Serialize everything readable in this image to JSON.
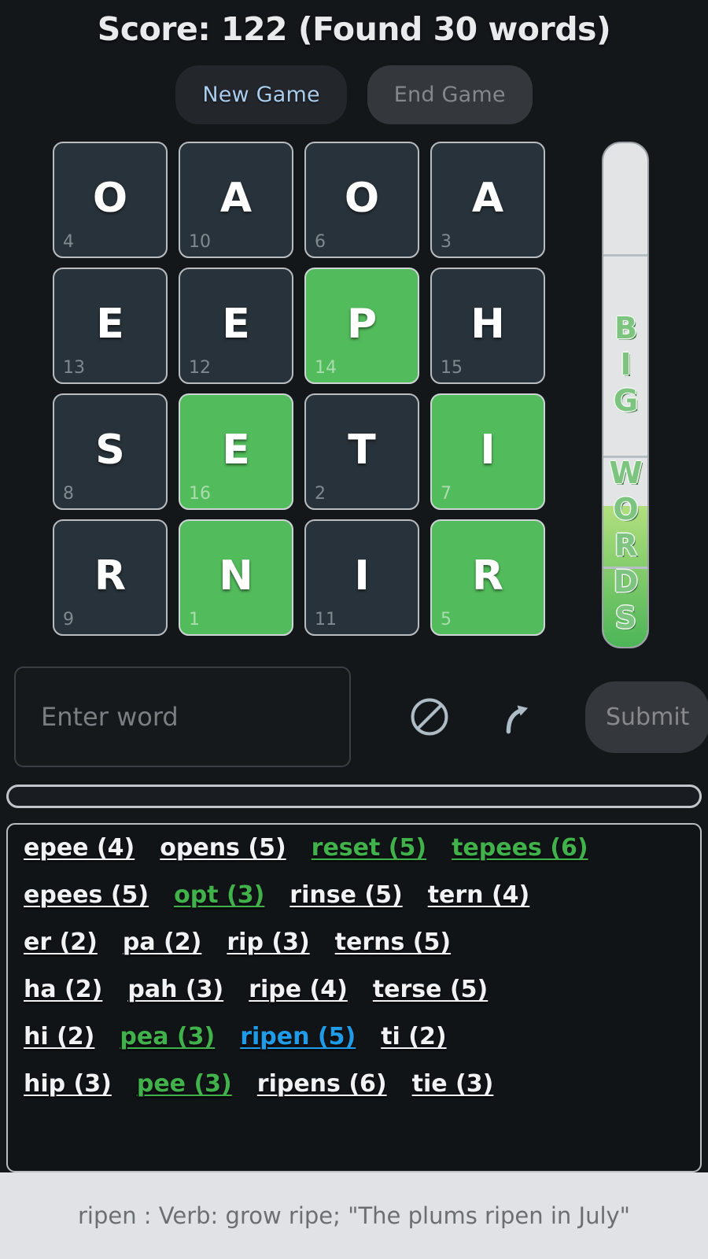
{
  "header": {
    "score_text": "Score: 122 (Found 30 words)",
    "score": 122,
    "found_words_count": 30
  },
  "toolbar": {
    "new_game_label": "New Game",
    "end_game_label": "End Game"
  },
  "board": {
    "rows": 4,
    "cols": 4,
    "tiles": [
      {
        "letter": "O",
        "index": "4",
        "selected": false
      },
      {
        "letter": "A",
        "index": "10",
        "selected": false
      },
      {
        "letter": "O",
        "index": "6",
        "selected": false
      },
      {
        "letter": "A",
        "index": "3",
        "selected": false
      },
      {
        "letter": "E",
        "index": "13",
        "selected": false
      },
      {
        "letter": "E",
        "index": "12",
        "selected": false
      },
      {
        "letter": "P",
        "index": "14",
        "selected": true
      },
      {
        "letter": "H",
        "index": "15",
        "selected": false
      },
      {
        "letter": "S",
        "index": "8",
        "selected": false
      },
      {
        "letter": "E",
        "index": "16",
        "selected": true
      },
      {
        "letter": "T",
        "index": "2",
        "selected": false
      },
      {
        "letter": "I",
        "index": "7",
        "selected": true
      },
      {
        "letter": "R",
        "index": "9",
        "selected": false
      },
      {
        "letter": "N",
        "index": "1",
        "selected": true
      },
      {
        "letter": "I",
        "index": "11",
        "selected": false
      },
      {
        "letter": "R",
        "index": "5",
        "selected": true
      }
    ]
  },
  "big_words_gauge": {
    "label": "BIG WORDS",
    "fill_percent": 28,
    "tick_percents": [
      22,
      62,
      84
    ]
  },
  "input": {
    "placeholder": "Enter word",
    "value": "",
    "clear_icon": "prohibited-circle-icon",
    "undo_icon": "curved-arrow-up-icon",
    "submit_label": "Submit"
  },
  "progress_bar": {
    "fill_percent": 0
  },
  "word_list": {
    "rows": [
      [
        {
          "text": "epee (4)",
          "state": "normal"
        },
        {
          "text": "opens (5)",
          "state": "normal"
        },
        {
          "text": "reset (5)",
          "state": "green"
        },
        {
          "text": "tepees (6)",
          "state": "green"
        }
      ],
      [
        {
          "text": "epees (5)",
          "state": "normal"
        },
        {
          "text": "opt (3)",
          "state": "green"
        },
        {
          "text": "rinse (5)",
          "state": "normal"
        },
        {
          "text": "tern (4)",
          "state": "normal"
        }
      ],
      [
        {
          "text": "er (2)",
          "state": "normal"
        },
        {
          "text": "pa (2)",
          "state": "normal"
        },
        {
          "text": "rip (3)",
          "state": "normal"
        },
        {
          "text": "terns (5)",
          "state": "normal"
        }
      ],
      [
        {
          "text": "ha (2)",
          "state": "normal"
        },
        {
          "text": "pah (3)",
          "state": "normal"
        },
        {
          "text": "ripe (4)",
          "state": "normal"
        },
        {
          "text": "terse (5)",
          "state": "normal"
        }
      ],
      [
        {
          "text": "hi (2)",
          "state": "normal"
        },
        {
          "text": "pea (3)",
          "state": "green"
        },
        {
          "text": "ripen (5)",
          "state": "blue"
        },
        {
          "text": "ti (2)",
          "state": "normal"
        }
      ],
      [
        {
          "text": "hip (3)",
          "state": "normal"
        },
        {
          "text": "pee (3)",
          "state": "green"
        },
        {
          "text": "ripens (6)",
          "state": "normal"
        },
        {
          "text": "tie (3)",
          "state": "normal"
        }
      ]
    ]
  },
  "definition": {
    "text": "ripen : Verb: grow ripe; \"The plums ripen in July\""
  },
  "colors": {
    "background": "#14171a",
    "tile_dark": "#28323a",
    "tile_green": "#52bb5b",
    "accent_green": "#41b14b",
    "accent_blue": "#1f9ce8",
    "new_game_text": "#aacdee",
    "footer_bg": "#e0e2e5"
  }
}
